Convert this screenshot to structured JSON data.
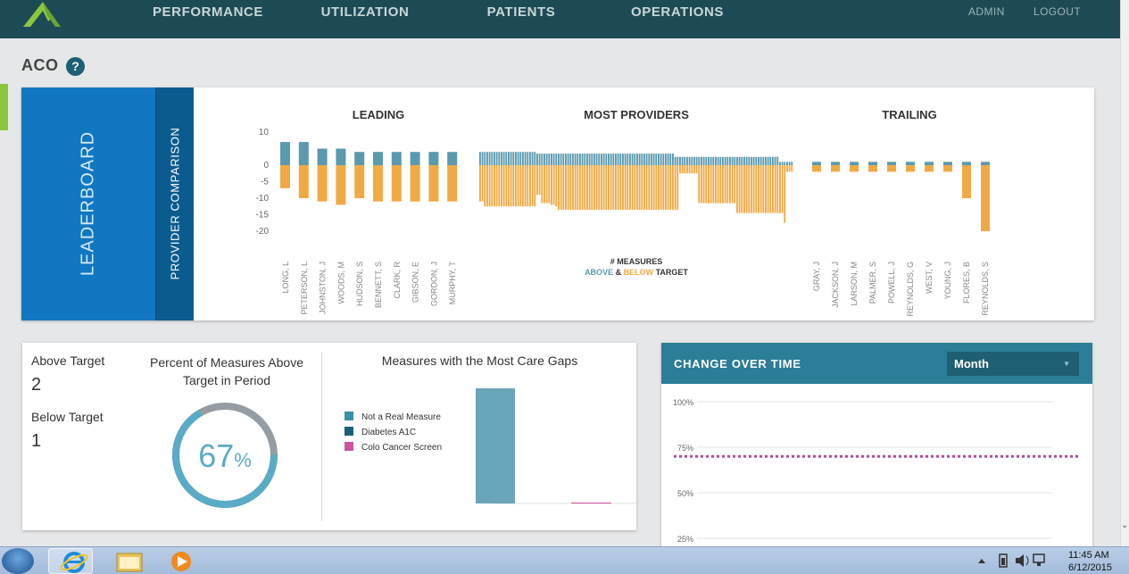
{
  "nav": {
    "tabs": [
      {
        "label": "PERFORMANCE",
        "active": true
      },
      {
        "label": "UTILIZATION",
        "active": false
      },
      {
        "label": "PATIENTS",
        "active": false
      },
      {
        "label": "OPERATIONS",
        "active": false
      }
    ],
    "admin": "ADMIN",
    "logout": "LOGOUT"
  },
  "page": {
    "title": "ACO",
    "help_icon": "question-icon"
  },
  "leaderboard": {
    "side_label": "LEADERBOARD",
    "sub_label": "PROVIDER COMPARISON",
    "chart_data": {
      "type": "bar",
      "sections": [
        "LEADING",
        "MOST PROVIDERS",
        "TRAILING"
      ],
      "y_ticks": [
        10,
        0,
        -5,
        -10,
        -15,
        -20
      ],
      "ylim": [
        -20,
        10
      ],
      "legend": {
        "line1": "# MEASURES",
        "above": "ABOVE",
        "amp": " & ",
        "below": "BELOW",
        "target": " TARGET"
      },
      "colors": {
        "above": "#5b9aae",
        "below": "#f0aa45"
      },
      "leading": [
        {
          "name": "LONG, L",
          "above": 7,
          "below": -7
        },
        {
          "name": "PETERSON, L",
          "above": 7,
          "below": -10
        },
        {
          "name": "JOHNSTON, J",
          "above": 5,
          "below": -11
        },
        {
          "name": "WOODS, M",
          "above": 5,
          "below": -12
        },
        {
          "name": "HUDSON, S",
          "above": 4,
          "below": -10
        },
        {
          "name": "BENNETT, S",
          "above": 4,
          "below": -11
        },
        {
          "name": "CLARK, R",
          "above": 4,
          "below": -11
        },
        {
          "name": "GIBSON, E",
          "above": 4,
          "below": -11
        },
        {
          "name": "GORDON, J",
          "above": 4,
          "below": -11
        },
        {
          "name": "MURPHY, T",
          "above": 4,
          "below": -11
        }
      ],
      "most_providers": {
        "above": [
          4,
          4,
          4,
          4,
          4,
          4,
          4,
          4,
          4,
          4,
          4,
          4,
          4,
          4,
          4,
          4,
          4,
          4,
          4,
          4,
          4,
          4,
          4,
          4,
          3.5,
          3.5,
          3.5,
          3.5,
          3.5,
          3.5,
          3.5,
          3.5,
          3.5,
          3.5,
          3.5,
          3.5,
          3.5,
          3.5,
          3.5,
          3.5,
          3.5,
          3.5,
          3.5,
          3.5,
          3.5,
          3.5,
          3.5,
          3.5,
          3.5,
          3.5,
          3.5,
          3.5,
          3.5,
          3.5,
          3.5,
          3.5,
          3.5,
          3.5,
          3.5,
          3.5,
          3.5,
          3.5,
          3.5,
          3.5,
          3.5,
          3.5,
          3.5,
          3.5,
          3.5,
          3.5,
          3.5,
          3.5,
          3.5,
          3.5,
          3.5,
          3.5,
          3.5,
          3.5,
          3.5,
          3.5,
          3.5,
          3.5,
          2.5,
          2.5,
          2.5,
          2.5,
          2.5,
          2.5,
          2.5,
          2.5,
          2.5,
          2.5,
          2.5,
          2.5,
          2.5,
          2.5,
          2.5,
          2.5,
          2.5,
          2.5,
          2.5,
          2.5,
          2.5,
          2.5,
          2.5,
          2.5,
          2.5,
          2.5,
          2.5,
          2.5,
          2.5,
          2.5,
          2.5,
          2.5,
          2.5,
          2.5,
          2.5,
          2.5,
          2.5,
          2.5,
          2.5,
          2.5,
          2.5,
          2.5,
          2.5,
          2.5,
          1,
          1,
          1,
          1,
          1,
          1
        ],
        "below": [
          -11,
          -11,
          -12.5,
          -12.5,
          -12.5,
          -12.5,
          -12.5,
          -12.5,
          -12.5,
          -12.5,
          -12.5,
          -12.5,
          -12.5,
          -12.5,
          -12.5,
          -12.5,
          -12.5,
          -12.5,
          -12.5,
          -12.5,
          -12.5,
          -12.5,
          -12.5,
          -12.5,
          -9,
          -9,
          -11.5,
          -11.5,
          -11.5,
          -11.5,
          -12,
          -12,
          -12.5,
          -13.5,
          -13.5,
          -13.5,
          -13.5,
          -13.5,
          -13.5,
          -13.5,
          -13.5,
          -13.5,
          -13.5,
          -13.5,
          -13.5,
          -13.5,
          -13.5,
          -13.5,
          -13.5,
          -13.5,
          -13.5,
          -13.5,
          -13.5,
          -13.5,
          -13.5,
          -13.5,
          -13.5,
          -13.5,
          -13.5,
          -13.5,
          -13.5,
          -13.5,
          -13.5,
          -13.5,
          -13.5,
          -13.5,
          -13.5,
          -13.5,
          -13.5,
          -13.5,
          -13.5,
          -13.5,
          -13.5,
          -13.5,
          -13.5,
          -13.5,
          -13.5,
          -13.5,
          -13.5,
          -13.5,
          -13.5,
          -13.5,
          -13.5,
          -13.5,
          -2.5,
          -2.5,
          -2.5,
          -2.5,
          -2.5,
          -2.5,
          -2.5,
          -2.5,
          -11.5,
          -11.5,
          -11.5,
          -11.5,
          -11.5,
          -11.5,
          -11.5,
          -11.5,
          -11.5,
          -11.5,
          -11.5,
          -11.5,
          -11.5,
          -11.5,
          -11.5,
          -11.5,
          -14.5,
          -14.5,
          -14.5,
          -14.5,
          -14.5,
          -14.5,
          -14.5,
          -14.5,
          -14.5,
          -14.5,
          -14.5,
          -14.5,
          -14.5,
          -14.5,
          -14.5,
          -14.5,
          -14.5,
          -14.5,
          -14.5,
          -14.5,
          -17.5,
          -2,
          -2,
          -2,
          -2,
          -2
        ]
      },
      "trailing": [
        {
          "name": "GRAY, J",
          "above": 1,
          "below": -2
        },
        {
          "name": "JACKSON, J",
          "above": 1,
          "below": -2
        },
        {
          "name": "LARSON, M",
          "above": 1,
          "below": -2
        },
        {
          "name": "PALMER, S",
          "above": 1,
          "below": -2
        },
        {
          "name": "POWELL, J",
          "above": 1,
          "below": -2
        },
        {
          "name": "REYNOLDS, G",
          "above": 1,
          "below": -2
        },
        {
          "name": "WEST, V",
          "above": 1,
          "below": -2
        },
        {
          "name": "YOUNG, J",
          "above": 1,
          "below": -2
        },
        {
          "name": "FLORES, B",
          "above": 1,
          "below": -10
        },
        {
          "name": "REYNOLDS, S",
          "above": 1,
          "below": -20
        }
      ]
    }
  },
  "summary": {
    "above_label": "Above Target",
    "above_value": "2",
    "below_label": "Below Target",
    "below_value": "1",
    "pct_title_1": "Percent of Measures Above",
    "pct_title_2": "Target in Period",
    "pct_value": "67",
    "pct_symbol": "%",
    "pct_fraction": 0.67,
    "colors": {
      "ring": "#5aabc6",
      "ring_bg": "#939da3"
    }
  },
  "care_gaps": {
    "title": "Measures with the Most Care Gaps",
    "legend": [
      {
        "label": "Not a Real Measure",
        "color": "#3a8fa5"
      },
      {
        "label": "Diabetes A1C",
        "color": "#1b5f7b"
      },
      {
        "label": "Colo Cancer Screen",
        "color": "#c9569d"
      }
    ],
    "chart_data": {
      "type": "bar",
      "series": [
        {
          "name": "Not a Real Measure",
          "value": 100
        },
        {
          "name": "Colo Cancer Screen",
          "value": 0.5
        }
      ],
      "colors": [
        "#6ba5b9",
        "#c9569d"
      ]
    }
  },
  "change_over_time": {
    "title": "CHANGE OVER TIME",
    "period": "Month",
    "chart_data": {
      "type": "line",
      "y_ticks": [
        "100%",
        "75%",
        "50%",
        "25%"
      ],
      "ylim": [
        25,
        100
      ],
      "series": [
        {
          "value": 70,
          "color": "#b04f98",
          "style": "dotted"
        }
      ]
    }
  },
  "taskbar": {
    "time": "11:45 AM",
    "date": "6/12/2015"
  }
}
